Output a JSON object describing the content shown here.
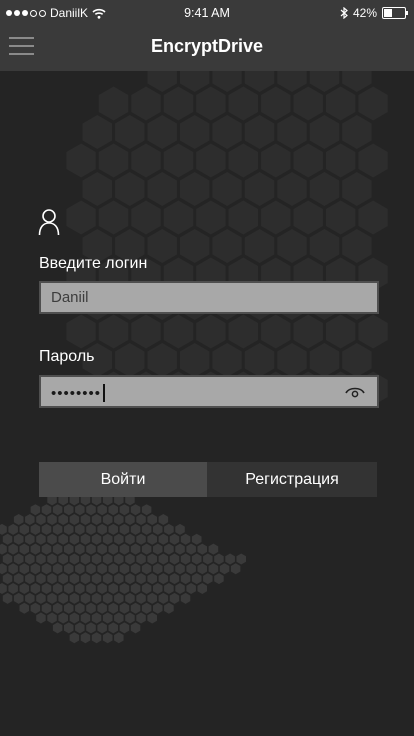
{
  "status_bar": {
    "carrier": "DaniilK",
    "time": "9:41 AM",
    "battery": "42%",
    "battery_level": 0.42,
    "signal_bars_filled": 3,
    "signal_bars_total": 5
  },
  "nav": {
    "title": "EncryptDrive",
    "menu_icon": "hamburger-menu-icon"
  },
  "form": {
    "login_label": "Введите логин",
    "login_value": "Daniil",
    "password_label": "Пароль",
    "password_masked": "••••••••",
    "user_icon": "user-icon",
    "eye_icon": "eye-icon"
  },
  "buttons": {
    "login": "Войти",
    "register": "Регистрация"
  },
  "colors": {
    "background": "#242424",
    "nav_bar": "#3a3a3a",
    "field_bg": "#a8a8a8",
    "login_button": "#4b4b4b",
    "register_button": "#333333"
  }
}
